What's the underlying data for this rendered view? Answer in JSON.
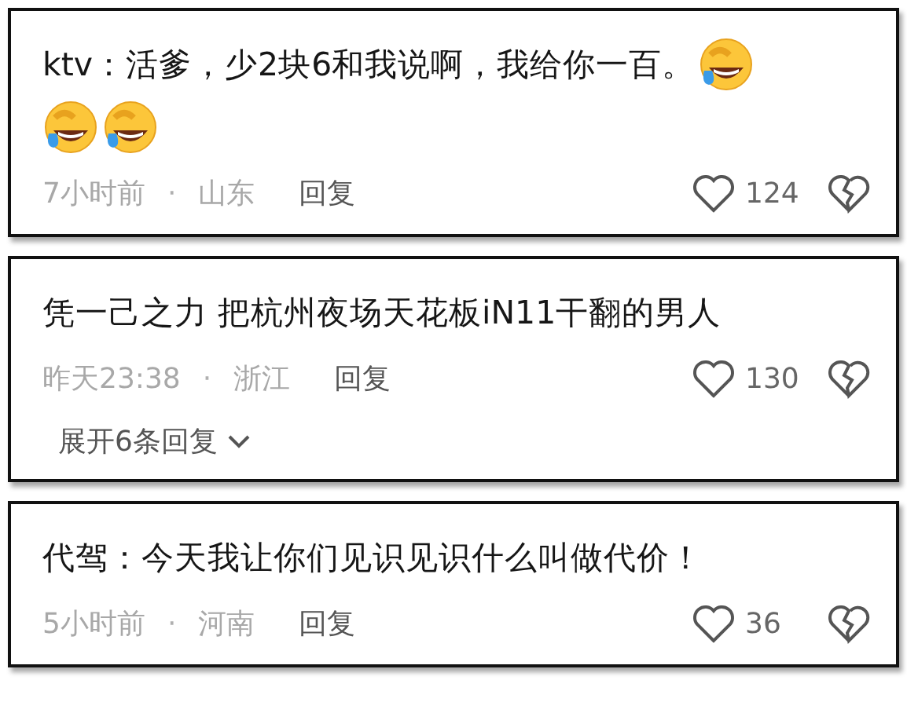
{
  "comments": [
    {
      "lines": [
        [
          {
            "kind": "text",
            "text": "ktv：活爹，少2块6和我说啊，我给你一百。"
          },
          {
            "kind": "emoji"
          }
        ],
        [
          {
            "kind": "emoji"
          },
          {
            "kind": "emoji"
          }
        ]
      ],
      "time": "7小时前",
      "separator": "·",
      "location": "山东",
      "reply": "回复",
      "likes": "124"
    },
    {
      "lines": [
        [
          {
            "kind": "text",
            "text": "凭一己之力 把杭州夜场天花板iN11干翻的男人"
          }
        ]
      ],
      "time": "昨天23:38",
      "separator": "·",
      "location": "浙江",
      "reply": "回复",
      "likes": "130",
      "expand": "展开6条回复"
    },
    {
      "lines": [
        [
          {
            "kind": "text",
            "text": "代驾：今天我让你们见识见识什么叫做代价！"
          }
        ]
      ],
      "time": "5小时前",
      "separator": "·",
      "location": "河南",
      "reply": "回复",
      "likes": "36"
    }
  ]
}
